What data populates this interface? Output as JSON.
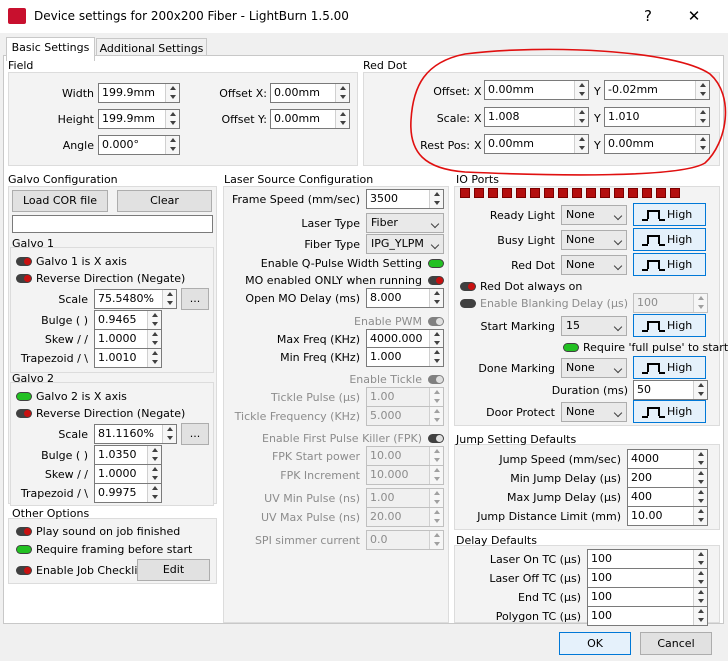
{
  "window": {
    "title": "Device settings for 200x200 Fiber - LightBurn 1.5.00",
    "help": "?",
    "close": "✕"
  },
  "tabs": [
    "Basic Settings",
    "Additional Settings"
  ],
  "field": {
    "title": "Field",
    "width_label": "Width",
    "width": "199.9mm",
    "height_label": "Height",
    "height": "199.9mm",
    "angle_label": "Angle",
    "angle": "0.000°",
    "offx_label": "Offset X:",
    "offx": "0.00mm",
    "offy_label": "Offset Y:",
    "offy": "0.00mm"
  },
  "reddot": {
    "title": "Red Dot",
    "offset_label": "Offset:",
    "scale_label": "Scale:",
    "rest_label": "Rest Pos:",
    "x": "X",
    "y": "Y",
    "offset_x": "0.00mm",
    "offset_y": "-0.02mm",
    "scale_x": "1.008",
    "scale_y": "1.010",
    "rest_x": "0.00mm",
    "rest_y": "0.00mm"
  },
  "galvo": {
    "title": "Galvo Configuration",
    "load_cor": "Load COR file",
    "clear": "Clear",
    "cor_path": "",
    "g1": {
      "title": "Galvo 1",
      "is_x": "Galvo 1 is X axis",
      "reverse": "Reverse Direction (Negate)",
      "scale_label": "Scale",
      "scale": "75.5480%",
      "bulge_label": "Bulge ( )",
      "bulge": "0.9465",
      "skew_label": "Skew / /",
      "skew": "1.0000",
      "trap_label": "Trapezoid / \\",
      "trap": "1.0010"
    },
    "g2": {
      "title": "Galvo 2",
      "is_x": "Galvo 2 is X axis",
      "reverse": "Reverse Direction (Negate)",
      "scale_label": "Scale",
      "scale": "81.1160%",
      "bulge_label": "Bulge ( )",
      "bulge": "1.0350",
      "skew_label": "Skew / /",
      "skew": "1.0000",
      "trap_label": "Trapezoid / \\",
      "trap": "0.9975"
    },
    "dots": "..."
  },
  "other": {
    "title": "Other Options",
    "play_sound": "Play sound on job finished",
    "require_framing": "Require framing before start",
    "job_checklist": "Enable Job Checklist",
    "edit": "Edit"
  },
  "laser": {
    "title": "Laser Source Configuration",
    "frame_speed_label": "Frame Speed (mm/sec)",
    "frame_speed": "3500",
    "laser_type_label": "Laser Type",
    "laser_type": "Fiber",
    "fiber_type_label": "Fiber Type",
    "fiber_type": "IPG_YLPM",
    "qpulse": "Enable Q-Pulse Width Setting",
    "mo_enabled": "MO enabled ONLY when running",
    "mo_delay_label": "Open MO Delay (ms)",
    "mo_delay": "8.000",
    "enable_pwm": "Enable PWM",
    "max_freq_label": "Max Freq (KHz)",
    "max_freq": "4000.000",
    "min_freq_label": "Min Freq (KHz)",
    "min_freq": "1.000",
    "enable_tickle": "Enable Tickle",
    "tickle_pulse_label": "Tickle Pulse (µs)",
    "tickle_pulse": "1.00",
    "tickle_freq_label": "Tickle Frequency (KHz)",
    "tickle_freq": "5.000",
    "fpk": "Enable First Pulse Killer (FPK)",
    "fpk_start_label": "FPK Start power",
    "fpk_start": "10.00",
    "fpk_inc_label": "FPK Increment",
    "fpk_inc": "10.000",
    "uv_min_label": "UV Min Pulse (ns)",
    "uv_min": "1.00",
    "uv_max_label": "UV Max Pulse (ns)",
    "uv_max": "20.00",
    "spi_label": "SPI simmer current",
    "spi": "0.0"
  },
  "io": {
    "title": "IO Ports",
    "ready_label": "Ready Light",
    "busy_label": "Busy Light",
    "reddot_label": "Red Dot",
    "none": "None",
    "high": "High",
    "reddot_always": "Red Dot always on",
    "blanking": "Enable Blanking",
    "delay_label": "Delay (µs)",
    "delay": "100",
    "start_label": "Start Marking",
    "start_val": "15",
    "full_pulse": "Require 'full pulse' to start",
    "done_label": "Done Marking",
    "duration_label": "Duration (ms)",
    "duration": "50",
    "door_label": "Door Protect"
  },
  "jump": {
    "title": "Jump Setting Defaults",
    "speed_label": "Jump Speed (mm/sec)",
    "speed": "4000",
    "min_label": "Min Jump Delay (µs)",
    "min": "200",
    "max_label": "Max Jump Delay (µs)",
    "max": "400",
    "limit_label": "Jump Distance Limit (mm)",
    "limit": "10.00"
  },
  "delay": {
    "title": "Delay Defaults",
    "on_label": "Laser On TC (µs)",
    "on": "100",
    "off_label": "Laser Off TC (µs)",
    "off": "100",
    "end_label": "End TC (µs)",
    "end": "100",
    "poly_label": "Polygon TC (µs)",
    "poly": "100"
  },
  "footer": {
    "ok": "OK",
    "cancel": "Cancel"
  },
  "colors": {
    "annotation": "#e01010",
    "toggle_on": "#22c022",
    "toggle_off": "#c81010",
    "accent": "#0078d7"
  }
}
